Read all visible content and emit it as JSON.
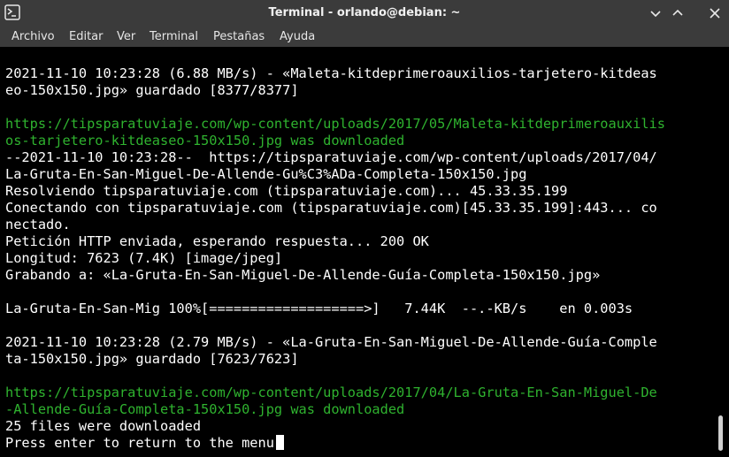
{
  "window": {
    "title": "Terminal - orlando@debian: ~"
  },
  "menu": [
    "Archivo",
    "Editar",
    "Ver",
    "Terminal",
    "Pestañas",
    "Ayuda"
  ],
  "colors": {
    "terminal_bg": "#000000",
    "text": "#ffffff",
    "success": "#2fb32f",
    "chrome": "#3b3b3b"
  },
  "icons": {
    "app": "terminal-icon",
    "minimize": "minimize-icon",
    "maximize": "maximize-icon",
    "close": "close-icon"
  },
  "terminal": {
    "lines": [
      {
        "text": "",
        "color": "white"
      },
      {
        "text": "2021-11-10 10:23:28 (6.88 MB/s) - «Maleta-kitdeprimeroauxilios-tarjetero-kitdeas",
        "color": "white"
      },
      {
        "text": "eo-150x150.jpg» guardado [8377/8377]",
        "color": "white"
      },
      {
        "text": "",
        "color": "white"
      },
      {
        "text": "https://tipsparatuviaje.com/wp-content/uploads/2017/05/Maleta-kitdeprimeroauxilis",
        "color": "green"
      },
      {
        "text": "os-tarjetero-kitdeaseo-150x150.jpg was downloaded",
        "color": "green"
      },
      {
        "text": "--2021-11-10 10:23:28--  https://tipsparatuviaje.com/wp-content/uploads/2017/04/",
        "color": "white"
      },
      {
        "text": "La-Gruta-En-San-Miguel-De-Allende-Gu%C3%ADa-Completa-150x150.jpg",
        "color": "white"
      },
      {
        "text": "Resolviendo tipsparatuviaje.com (tipsparatuviaje.com)... 45.33.35.199",
        "color": "white"
      },
      {
        "text": "Conectando con tipsparatuviaje.com (tipsparatuviaje.com)[45.33.35.199]:443... co",
        "color": "white"
      },
      {
        "text": "nectado.",
        "color": "white"
      },
      {
        "text": "Petición HTTP enviada, esperando respuesta... 200 OK",
        "color": "white"
      },
      {
        "text": "Longitud: 7623 (7.4K) [image/jpeg]",
        "color": "white"
      },
      {
        "text": "Grabando a: «La-Gruta-En-San-Miguel-De-Allende-Guía-Completa-150x150.jpg»",
        "color": "white"
      },
      {
        "text": "",
        "color": "white"
      },
      {
        "text": "La-Gruta-En-San-Mig 100%[===================>]   7.44K  --.-KB/s    en 0.003s",
        "color": "white"
      },
      {
        "text": "",
        "color": "white"
      },
      {
        "text": "2021-11-10 10:23:28 (2.79 MB/s) - «La-Gruta-En-San-Miguel-De-Allende-Guía-Comple",
        "color": "white"
      },
      {
        "text": "ta-150x150.jpg» guardado [7623/7623]",
        "color": "white"
      },
      {
        "text": "",
        "color": "white"
      },
      {
        "text": "https://tipsparatuviaje.com/wp-content/uploads/2017/04/La-Gruta-En-San-Miguel-De",
        "color": "green"
      },
      {
        "text": "-Allende-Guía-Completa-150x150.jpg was downloaded",
        "color": "green"
      },
      {
        "text": "25 files were downloaded",
        "color": "white"
      },
      {
        "text": "Press enter to return to the menu",
        "color": "white",
        "cursor": true
      }
    ]
  }
}
